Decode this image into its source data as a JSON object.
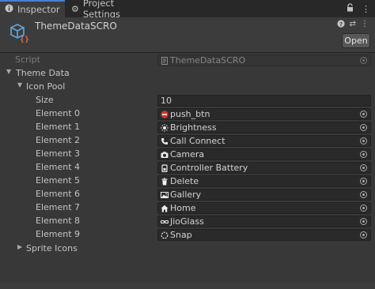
{
  "tabs": [
    {
      "label": "Inspector",
      "icon": "info-icon"
    },
    {
      "label": "Project Settings",
      "icon": "gear-icon"
    }
  ],
  "window_controls": [
    "lock-icon",
    "more-options-icon"
  ],
  "header": {
    "title": "ThemeDataSCRO",
    "open_label": "Open",
    "tools": [
      "help-icon",
      "preset-icon",
      "more-options-icon"
    ]
  },
  "script_row": {
    "label": "Script",
    "value": "ThemeDataSCRO"
  },
  "theme_data": {
    "label": "Theme Data",
    "icon_pool": {
      "label": "Icon Pool",
      "size_label": "Size",
      "size_value": "10",
      "elements": [
        {
          "label": "Element 0",
          "value": "push_btn",
          "icon": "no-entry-icon"
        },
        {
          "label": "Element 1",
          "value": "Brightness",
          "icon": "brightness-icon"
        },
        {
          "label": "Element 2",
          "value": "Call Connect",
          "icon": "phone-icon"
        },
        {
          "label": "Element 3",
          "value": "Camera",
          "icon": "camera-icon"
        },
        {
          "label": "Element 4",
          "value": "Controller Battery",
          "icon": "battery-icon"
        },
        {
          "label": "Element 5",
          "value": "Delete",
          "icon": "trash-icon"
        },
        {
          "label": "Element 6",
          "value": "Gallery",
          "icon": "image-icon"
        },
        {
          "label": "Element 7",
          "value": "Home",
          "icon": "home-icon"
        },
        {
          "label": "Element 8",
          "value": "JioGlass",
          "icon": "glasses-icon"
        },
        {
          "label": "Element 9",
          "value": "Snap",
          "icon": "snap-icon"
        }
      ]
    },
    "sprite_icons_label": "Sprite Icons"
  }
}
